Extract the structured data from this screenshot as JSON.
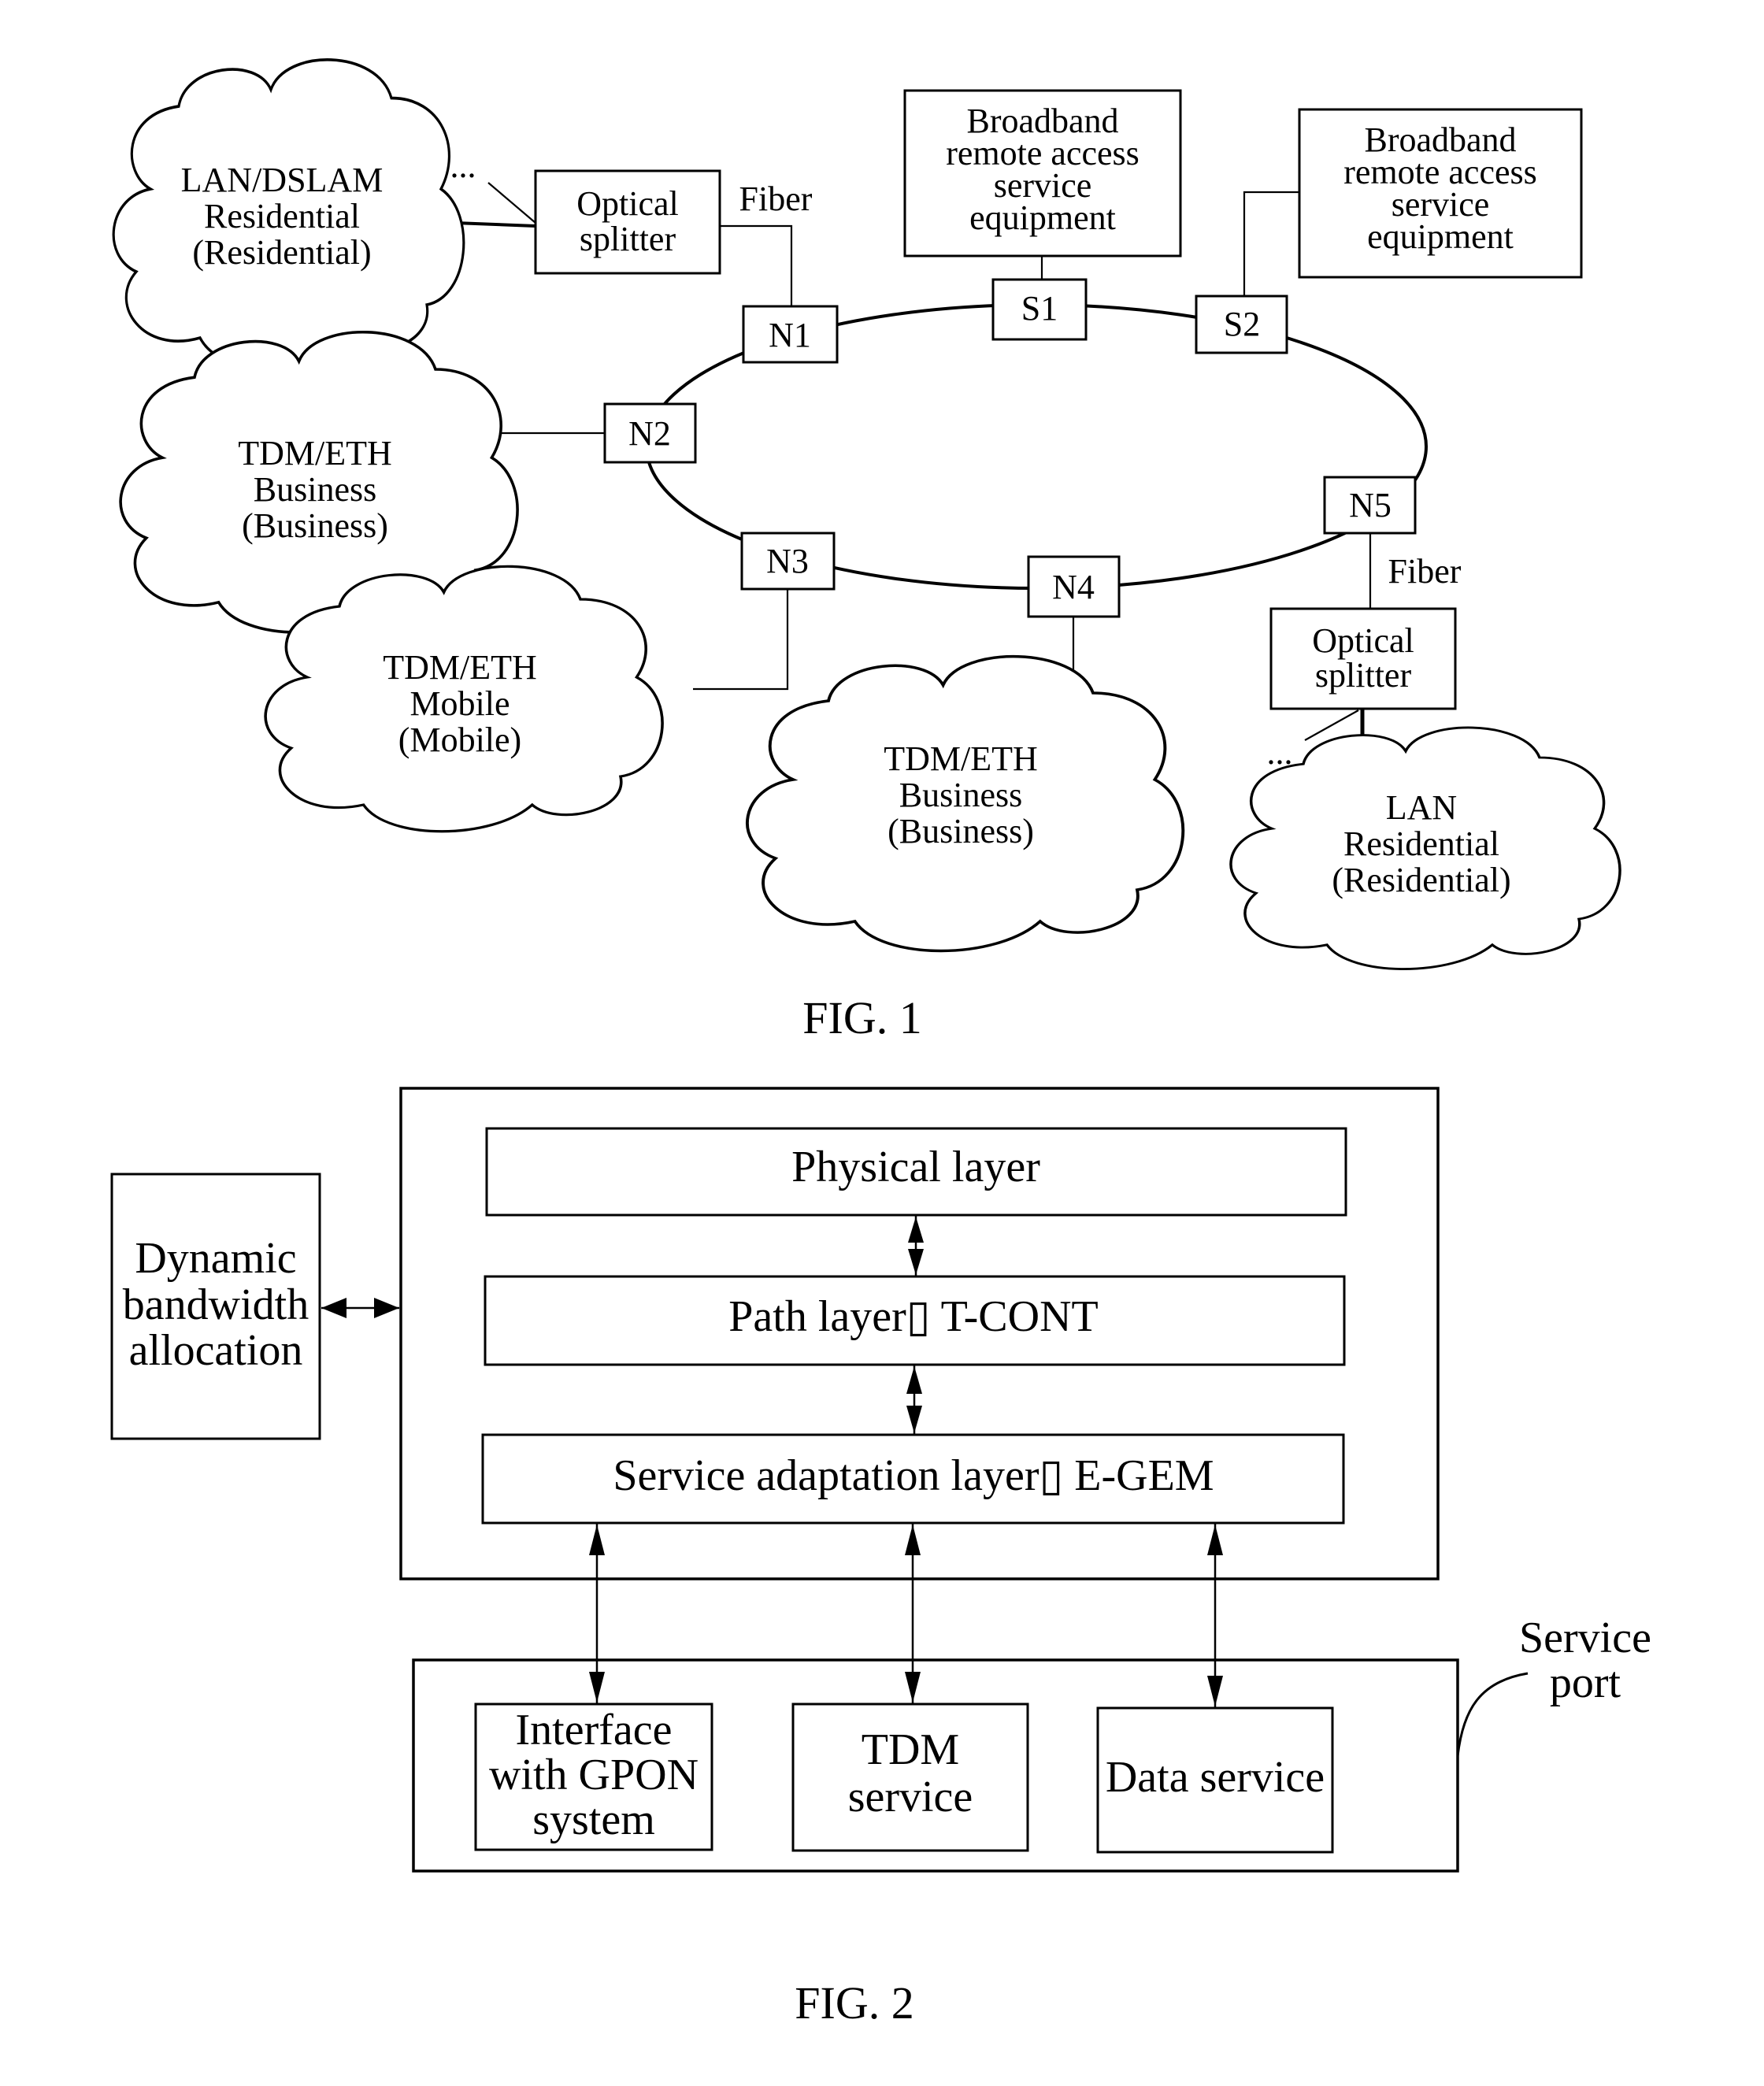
{
  "fig1": {
    "caption": "FIG. 1",
    "clouds": [
      {
        "id": "lan-dslam",
        "lines": [
          "LAN/DSLAM",
          "Residential",
          "(Residential)"
        ]
      },
      {
        "id": "tdm-eth-business-1",
        "lines": [
          "TDM/ETH",
          "Business",
          "(Business)"
        ]
      },
      {
        "id": "tdm-eth-mobile",
        "lines": [
          "TDM/ETH",
          "Mobile",
          "(Mobile)"
        ]
      },
      {
        "id": "tdm-eth-business-2",
        "lines": [
          "TDM/ETH",
          "Business",
          "(Business)"
        ]
      },
      {
        "id": "lan-residential",
        "lines": [
          "LAN",
          "Residential",
          "(Residential)"
        ]
      }
    ],
    "splitters": [
      {
        "lines": [
          "Optical",
          "splitter"
        ]
      },
      {
        "lines": [
          "Optical",
          "splitter"
        ]
      }
    ],
    "fiber_labels": [
      "Fiber",
      "Fiber"
    ],
    "ellipsis": [
      "...",
      "..."
    ],
    "bras": [
      {
        "lines": [
          "Broadband",
          "remote access",
          "service",
          "equipment"
        ]
      },
      {
        "lines": [
          "Broadband",
          "remote access",
          "service",
          "equipment"
        ]
      }
    ],
    "nodes": [
      "N1",
      "N2",
      "N3",
      "N4",
      "N5",
      "S1",
      "S2"
    ]
  },
  "fig2": {
    "caption": "FIG. 2",
    "layers": [
      "Physical layer",
      "Path layer▯   T-CONT",
      "Service adaptation layer▯   E-GEM"
    ],
    "dba": [
      "Dynamic",
      "bandwidth",
      "allocation"
    ],
    "service_port_label": [
      "Service",
      "port"
    ],
    "services": [
      {
        "lines": [
          "Interface",
          "with GPON",
          "system"
        ]
      },
      {
        "lines": [
          "TDM",
          "service"
        ]
      },
      {
        "lines": [
          "Data service"
        ]
      }
    ]
  }
}
